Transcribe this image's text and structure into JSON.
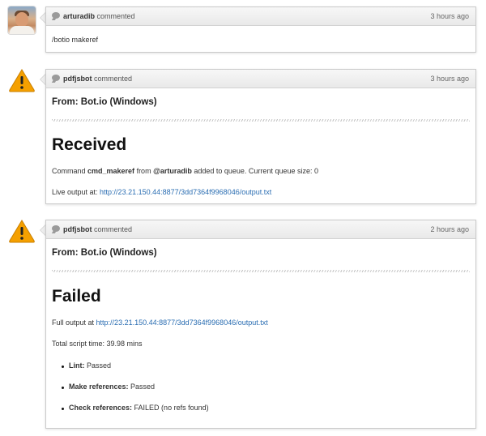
{
  "comments": [
    {
      "author": "arturadib",
      "action": "commented",
      "time": "3 hours ago",
      "text": "/botio makeref"
    },
    {
      "author": "pdfjsbot",
      "action": "commented",
      "time": "3 hours ago",
      "heading": "From: Bot.io (Windows)",
      "status": "Received",
      "message": {
        "prefix": "Command ",
        "command": "cmd_makeref",
        "mid": " from ",
        "user": "@arturadib",
        "suffix": " added to queue. Current queue size: 0"
      },
      "live_label": "Live output at: ",
      "live_url": "http://23.21.150.44:8877/3dd7364f9968046/output.txt"
    },
    {
      "author": "pdfjsbot",
      "action": "commented",
      "time": "2 hours ago",
      "heading": "From: Bot.io (Windows)",
      "status": "Failed",
      "full_label": "Full output at ",
      "full_url": "http://23.21.150.44:8877/3dd7364f9968046/output.txt",
      "script_time": "Total script time: 39.98 mins",
      "results": [
        {
          "label": "Lint:",
          "value": " Passed"
        },
        {
          "label": "Make references:",
          "value": " Passed"
        },
        {
          "label": "Check references:",
          "value": " FAILED (no refs found)"
        }
      ]
    }
  ],
  "colors": {
    "link": "#2a6db2",
    "warning_fill": "#f5a000",
    "border": "#cacaca"
  },
  "icons": [
    "avatar",
    "warning-icon",
    "comment-bubble-icon"
  ]
}
